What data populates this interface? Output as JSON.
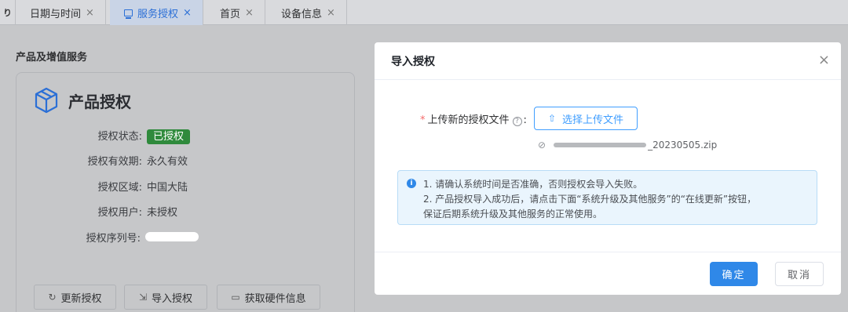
{
  "tabs": {
    "toggle_glyph": "り",
    "items": [
      {
        "label": "日期与时间",
        "close": "×"
      },
      {
        "label": "服务授权",
        "close": "×"
      },
      {
        "label": "首页",
        "close": "×"
      },
      {
        "label": "设备信息",
        "close": "×"
      }
    ]
  },
  "page": {
    "section_title": "产品及增值服务",
    "card": {
      "title": "产品授权",
      "icon": "cube-icon",
      "rows": [
        {
          "label": "授权状态:",
          "value": "已授权"
        },
        {
          "label": "授权有效期:",
          "value": "永久有效"
        },
        {
          "label": "授权区域:",
          "value": "中国大陆"
        },
        {
          "label": "授权用户:",
          "value": "未授权"
        },
        {
          "label": "授权序列号:",
          "value": ""
        }
      ],
      "buttons": [
        {
          "icon": "refresh-icon",
          "label": "更新授权"
        },
        {
          "icon": "import-icon",
          "label": "导入授权"
        },
        {
          "icon": "monitor-icon",
          "label": "获取硬件信息"
        }
      ]
    }
  },
  "modal": {
    "title": "导入授权",
    "close": "×",
    "form_label": "上传新的授权文件",
    "required_mark": "*",
    "help_glyph": "?",
    "upload_button": "选择上传文件",
    "file_name_suffix": "_20230505.zip",
    "alert_lines": [
      "1. 请确认系统时间是否准确，否则授权会导入失败。",
      "2. 产品授权导入成功后，请点击下面“系统升级及其他服务”的“在线更新”按钮，",
      "保证后期系统升级及其他服务的正常使用。"
    ],
    "confirm": "确定",
    "cancel": "取消"
  },
  "colors": {
    "primary": "#2f88e8",
    "success_badge": "#2f8a3c",
    "required": "#f56c6c",
    "active_tab_text": "#2b6fd6"
  }
}
